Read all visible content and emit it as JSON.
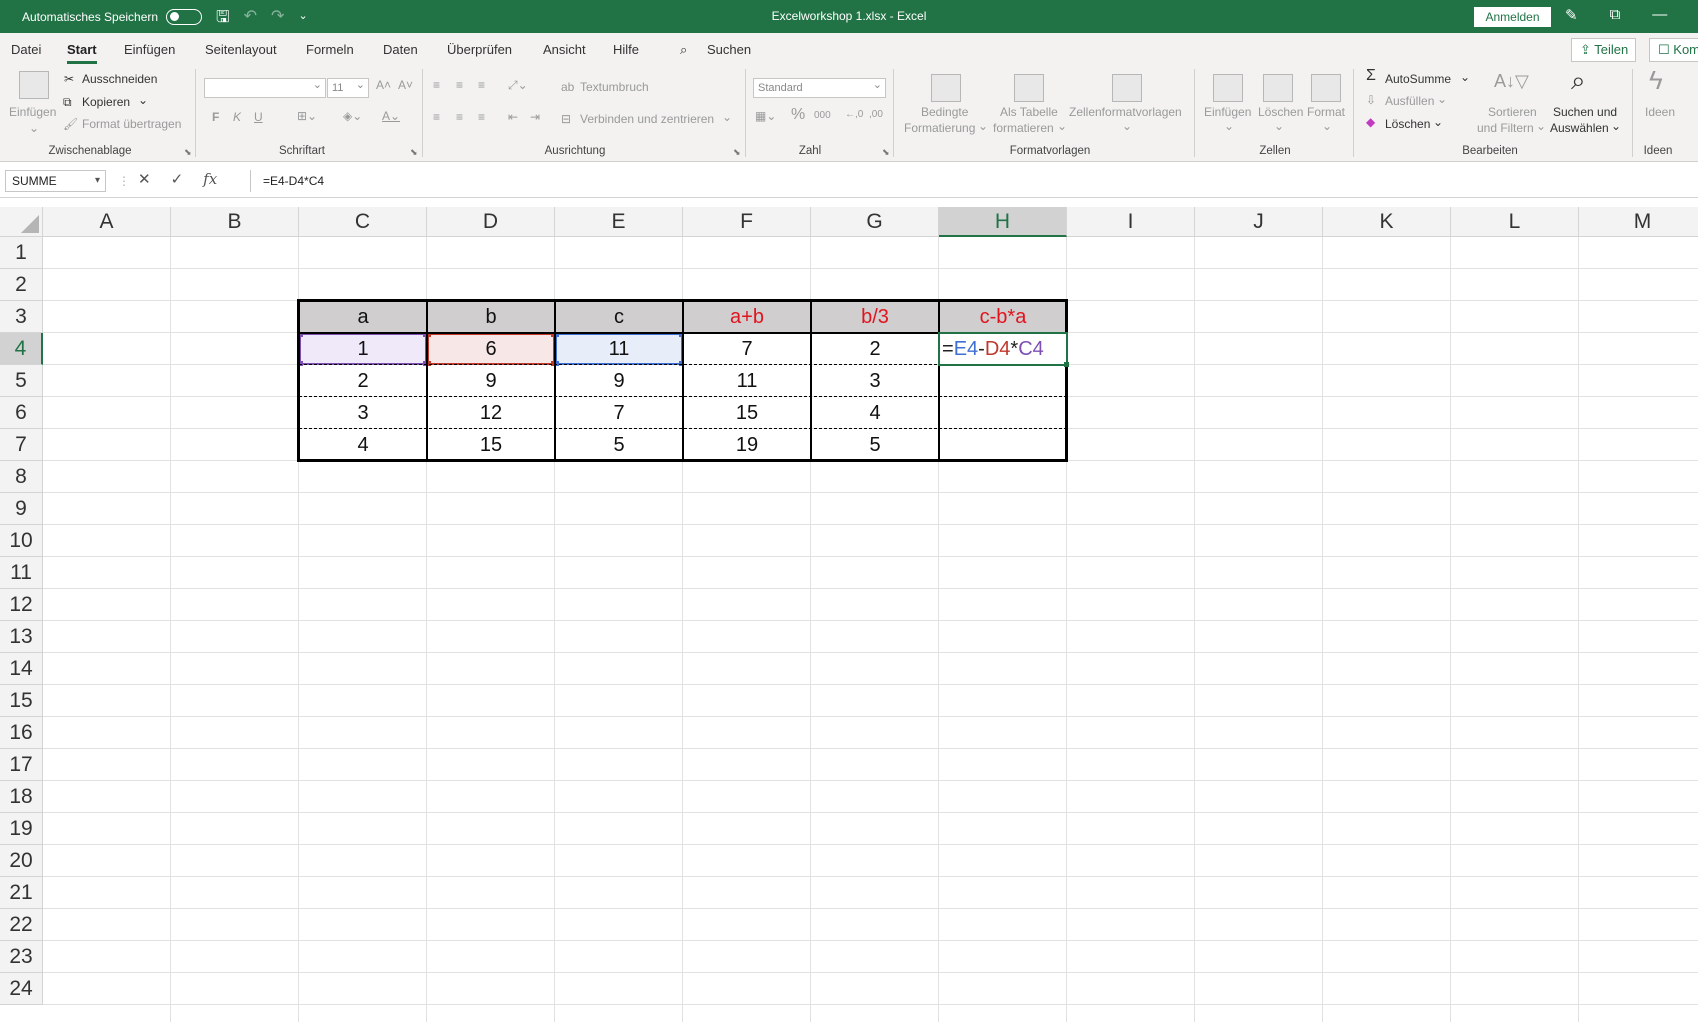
{
  "titlebar": {
    "autosave_label": "Automatisches Speichern",
    "title": "Excelworkshop 1.xlsx  -  Excel",
    "signin_label": "Anmelden"
  },
  "menu": {
    "tabs": [
      "Datei",
      "Start",
      "Einfügen",
      "Seitenlayout",
      "Formeln",
      "Daten",
      "Überprüfen",
      "Ansicht",
      "Hilfe"
    ],
    "active_tab": "Start",
    "search_label": "Suchen",
    "share_label": "Teilen",
    "comment_label": "Kom"
  },
  "ribbon": {
    "clipboard": {
      "paste": "Einfügen",
      "cut": "Ausschneiden",
      "copy": "Kopieren",
      "format_painter": "Format übertragen",
      "label": "Zwischenablage"
    },
    "font": {
      "size": "11",
      "bold": "F",
      "italic": "K",
      "underline": "U",
      "label": "Schriftart"
    },
    "alignment": {
      "wrap": "Textumbruch",
      "merge": "Verbinden und zentrieren",
      "label": "Ausrichtung"
    },
    "number": {
      "format": "Standard",
      "label": "Zahl"
    },
    "styles": {
      "conditional_1": "Bedingte",
      "conditional_2": "Formatierung",
      "table_1": "Als Tabelle",
      "table_2": "formatieren",
      "cell_styles": "Zellenformatvorlagen",
      "label": "Formatvorlagen"
    },
    "cells": {
      "insert": "Einfügen",
      "delete": "Löschen",
      "format": "Format",
      "label": "Zellen"
    },
    "editing": {
      "autosum": "AutoSumme",
      "fill": "Ausfüllen",
      "clear": "Löschen",
      "sort_1": "Sortieren",
      "sort_2": "und Filtern",
      "find_1": "Suchen und",
      "find_2": "Auswählen",
      "label": "Bearbeiten"
    },
    "ideas": {
      "button": "Ideen",
      "label": "Ideen"
    }
  },
  "formula_bar": {
    "name_box": "SUMME",
    "formula": "=E4-D4*C4"
  },
  "grid": {
    "columns": [
      "A",
      "B",
      "C",
      "D",
      "E",
      "F",
      "G",
      "H",
      "I",
      "J",
      "K",
      "L",
      "M"
    ],
    "selected_column": "H",
    "rows": [
      "1",
      "2",
      "3",
      "4",
      "5",
      "6",
      "7",
      "8",
      "9",
      "10",
      "11",
      "12",
      "13",
      "14",
      "15",
      "16",
      "17",
      "18",
      "19",
      "20",
      "21",
      "22",
      "23",
      "24"
    ],
    "selected_row": "4",
    "table_headers": [
      "a",
      "b",
      "c",
      "a+b",
      "b/3",
      "c-b*a"
    ],
    "table_rows": [
      [
        "1",
        "6",
        "11",
        "7",
        "2"
      ],
      [
        "2",
        "9",
        "9",
        "11",
        "3"
      ],
      [
        "3",
        "12",
        "7",
        "15",
        "4"
      ],
      [
        "4",
        "15",
        "5",
        "19",
        "5"
      ]
    ],
    "active_cell_formula": {
      "eq": "=",
      "ref1": "E4",
      "op1": "-",
      "ref2": "D4",
      "op2": "*",
      "ref3": "C4"
    },
    "ref_colors": {
      "E4": "#3f6fd0",
      "D4": "#c0392b",
      "C4": "#7d4fb3"
    }
  }
}
